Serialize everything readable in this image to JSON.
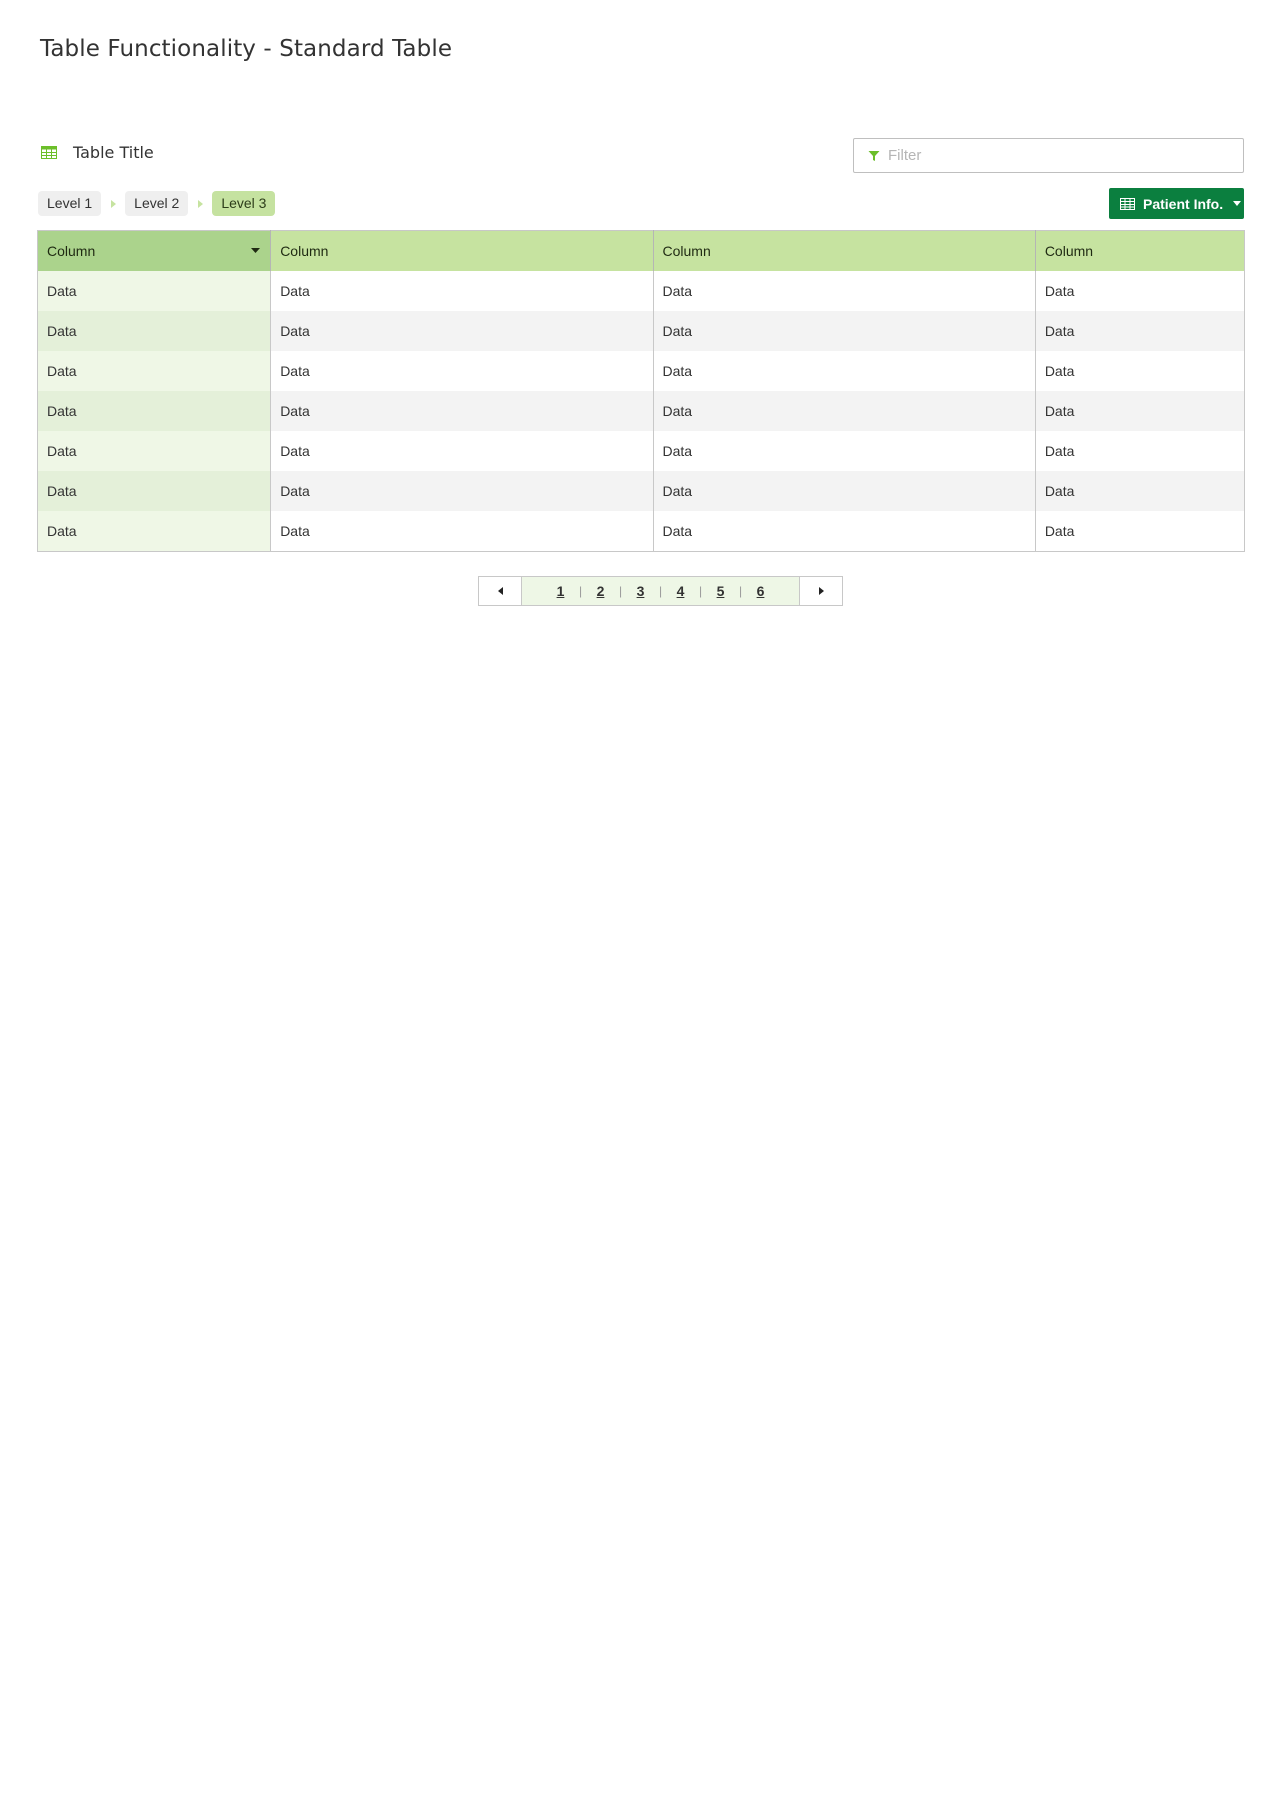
{
  "page": {
    "title": "Table Functionality - Standard Table"
  },
  "table_header": {
    "title": "Table Title",
    "icon": "table-grid-icon"
  },
  "filter": {
    "placeholder": "Filter",
    "value": "",
    "icon": "funnel-icon"
  },
  "breadcrumb": {
    "items": [
      {
        "label": "Level 1",
        "active": false
      },
      {
        "label": "Level 2",
        "active": false
      },
      {
        "label": "Level 3",
        "active": true
      }
    ]
  },
  "patient_button": {
    "label": "Patient Info.",
    "icon": "table-icon",
    "color": "#0b7f3f"
  },
  "table": {
    "columns": [
      "Column",
      "Column",
      "Column",
      "Column"
    ],
    "sorted_column": 0,
    "rows": [
      [
        "Data",
        "Data",
        "Data",
        "Data"
      ],
      [
        "Data",
        "Data",
        "Data",
        "Data"
      ],
      [
        "Data",
        "Data",
        "Data",
        "Data"
      ],
      [
        "Data",
        "Data",
        "Data",
        "Data"
      ],
      [
        "Data",
        "Data",
        "Data",
        "Data"
      ],
      [
        "Data",
        "Data",
        "Data",
        "Data"
      ],
      [
        "Data",
        "Data",
        "Data",
        "Data"
      ]
    ]
  },
  "pagination": {
    "pages": [
      "1",
      "2",
      "3",
      "4",
      "5",
      "6"
    ],
    "separator": "|"
  },
  "colors": {
    "header_green": "#c6e3a0",
    "sorted_header_green": "#abd38c",
    "accent_green": "#6cbf2a",
    "button_green": "#0b7f3f"
  }
}
